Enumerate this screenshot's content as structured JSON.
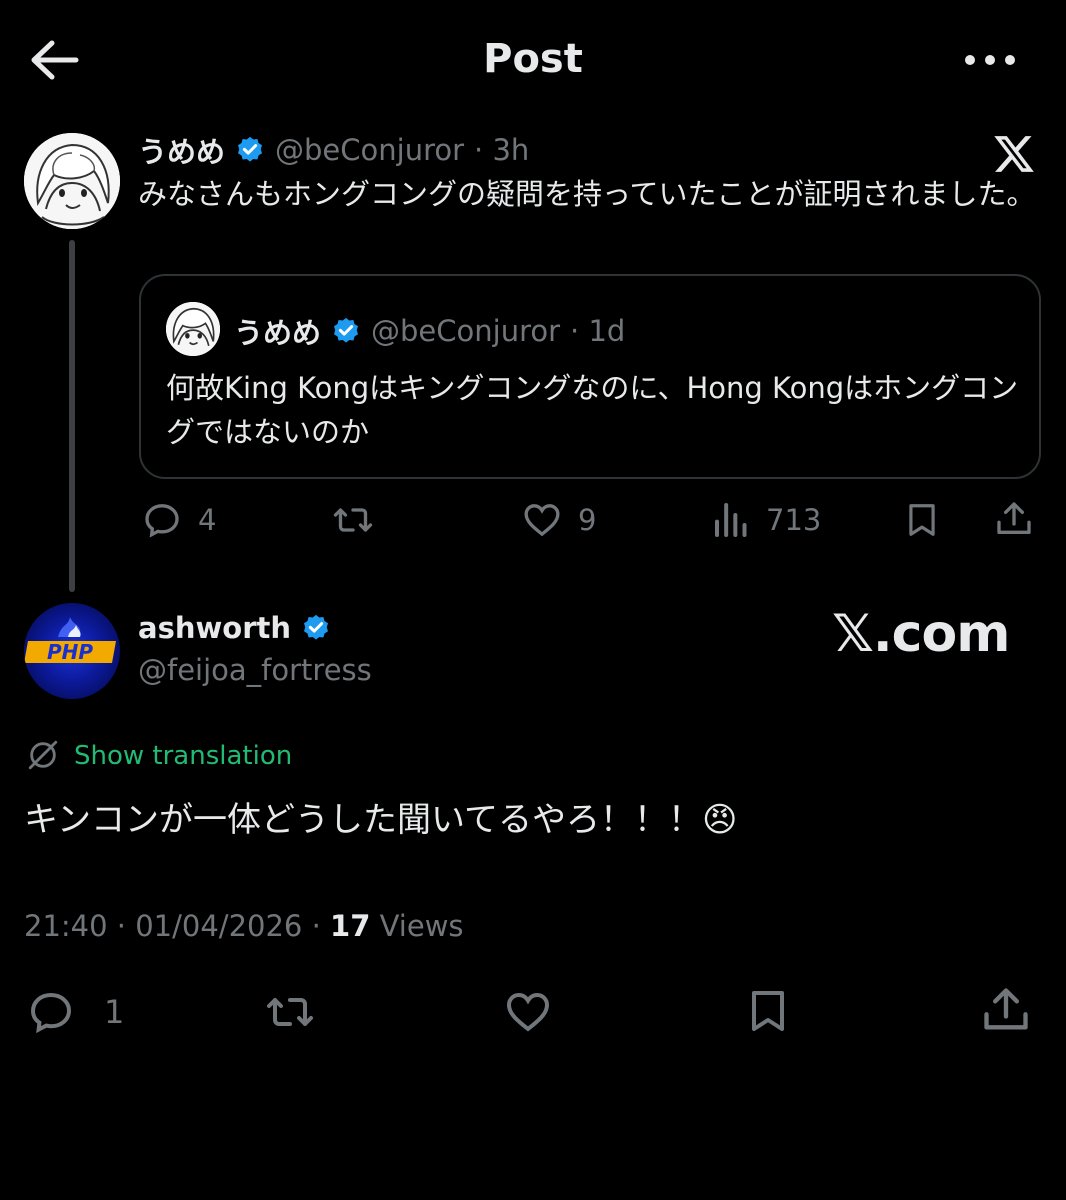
{
  "header": {
    "title": "Post",
    "back_icon": "arrow-left-icon",
    "more_icon": "more-horizontal-icon"
  },
  "parent_post": {
    "display_name": "うめめ",
    "handle": "@beConjuror",
    "time": "· 3h",
    "text": "みなさんもホングコングの疑問を持っていたことが証明されました。",
    "quote": {
      "display_name": "うめめ",
      "handle": "@beConjuror",
      "time": "· 1d",
      "text": "何故King Kongはキングコングなのに、Hong Kongはホングコングではないのか"
    },
    "actions": {
      "replies": "4",
      "likes": "9",
      "views": "713"
    }
  },
  "main_post": {
    "display_name": "ashworth",
    "handle": "@feijoa_fortress",
    "watermark": "𝕏.com",
    "translation_label": "Show translation",
    "text": "キンコンが一体どうした聞いてるやろ！！！😠",
    "timestamp": "21:40 · 01/04/2026 · ",
    "views_count": "17",
    "views_label": "Views",
    "reply_count": "1"
  },
  "colors": {
    "background": "#000000",
    "text": "#e7e9ea",
    "muted": "#71767b",
    "verified": "#1d9bf0",
    "translate": "#22bb73",
    "border": "#2f3336"
  }
}
